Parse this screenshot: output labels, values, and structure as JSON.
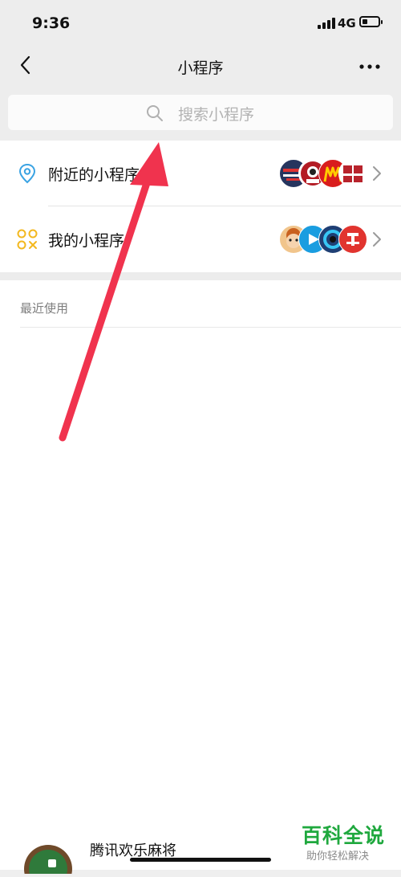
{
  "status": {
    "time": "9:36",
    "network": "4G"
  },
  "nav": {
    "title": "小程序",
    "back_icon": "chevron-left-icon",
    "more_icon": "more-dots-icon"
  },
  "search": {
    "placeholder": "搜索小程序",
    "icon": "search-icon"
  },
  "menu": {
    "items": [
      {
        "label": "附近的小程序",
        "icon": "location-pin-icon",
        "accent": "#3aa3e3"
      },
      {
        "label": "我的小程序",
        "icon": "mini-program-icon",
        "accent": "#f3b81f"
      }
    ]
  },
  "recent": {
    "header": "最近使用"
  },
  "peek": {
    "label": "腾讯欢乐麻将"
  },
  "watermark": {
    "title": "百科全说",
    "subtitle": "助你轻松解决"
  },
  "colors": {
    "arrow": "#f0334e",
    "watermark_green": "#1fa83e"
  }
}
